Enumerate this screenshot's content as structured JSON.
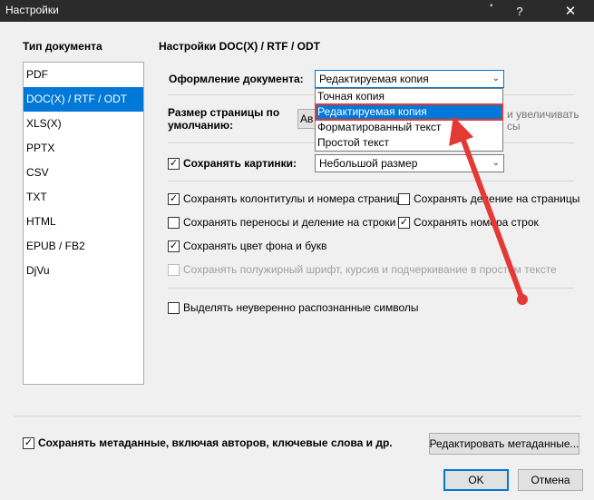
{
  "window": {
    "title": "Настройки",
    "help_symbol": "?",
    "close_symbol": "✕"
  },
  "left": {
    "header": "Тип документа",
    "items": [
      "PDF",
      "DOC(X) / RTF / ODT",
      "XLS(X)",
      "PPTX",
      "CSV",
      "TXT",
      "HTML",
      "EPUB / FB2",
      "DjVu"
    ],
    "selected_index": 1
  },
  "right": {
    "header": "Настройки DOC(X) / RTF / ODT",
    "layout_label": "Оформление документа:",
    "layout_value": "Редактируемая копия",
    "layout_options": [
      "Точная копия",
      "Редактируемая копия",
      "Форматированный текст",
      "Простой текст"
    ],
    "layout_selected_index": 1,
    "page_size_label": "Размер страницы по умолчанию:",
    "page_size_button_partial": "Ав",
    "hint_partial_1": "и увеличивать",
    "hint_partial_2": "сы",
    "save_pictures_label": "Сохранять картинки:",
    "save_pictures_checked": true,
    "picture_size_value": "Небольшой размер",
    "options": [
      {
        "label": "Сохранять колонтитулы и номера страниц",
        "checked": true,
        "disabled": false
      },
      {
        "label": "Сохранять деление на страницы",
        "checked": false,
        "disabled": false
      },
      {
        "label": "Сохранять переносы и деление на строки",
        "checked": false,
        "disabled": false
      },
      {
        "label": "Сохранять номера строк",
        "checked": true,
        "disabled": false
      },
      {
        "label": "Сохранять цвет фона и букв",
        "checked": true,
        "disabled": false
      },
      {
        "label": "Сохранять полужирный шрифт, курсив и подчеркивание в простом тексте",
        "checked": false,
        "disabled": true
      }
    ],
    "highlight_uncertain_label": "Выделять неуверенно распознанные символы",
    "highlight_uncertain_checked": false
  },
  "footer": {
    "save_metadata_label": "Сохранять метаданные, включая авторов, ключевые слова и др.",
    "save_metadata_checked": true,
    "edit_metadata_button": "Редактировать метаданные...",
    "ok_button": "OK",
    "cancel_button": "Отмена"
  },
  "colors": {
    "accent": "#0078d7",
    "annotation": "#e53935",
    "titlebar": "#2b2b2b"
  },
  "icons": {
    "check": "✓",
    "chevron": "⌄"
  }
}
